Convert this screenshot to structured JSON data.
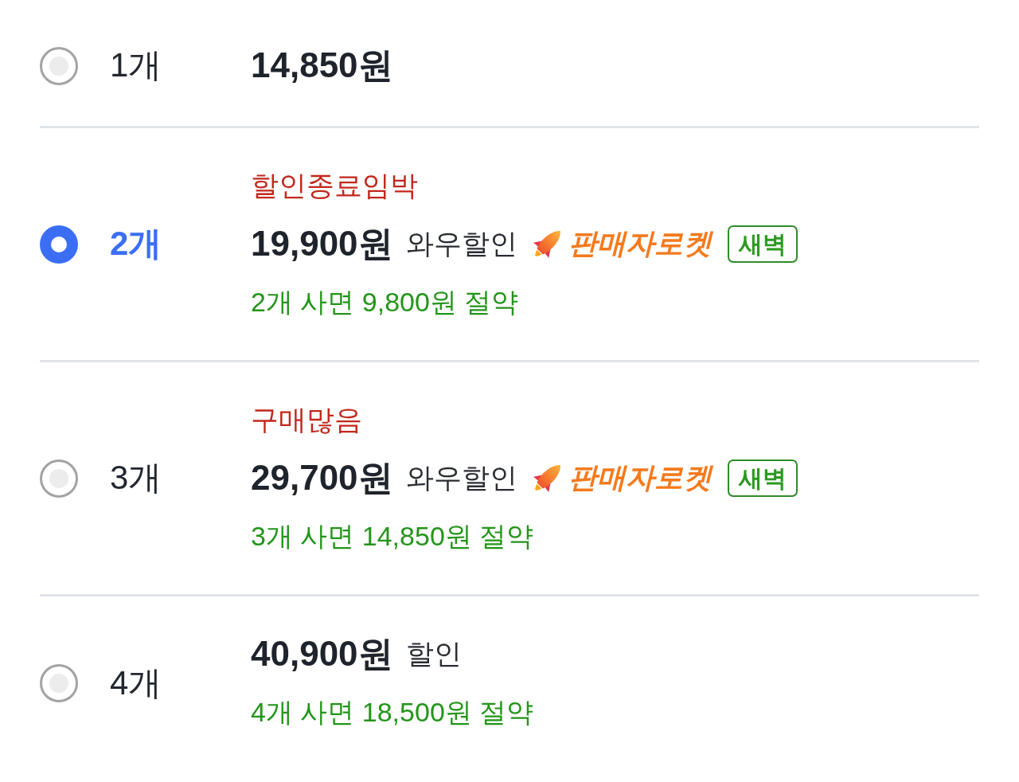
{
  "options": [
    {
      "quantity": "1개",
      "selected": false,
      "price": "14,850원"
    },
    {
      "quantity": "2개",
      "selected": true,
      "tag": "할인종료임박",
      "price": "19,900원",
      "discount": "와우할인",
      "delivery": {
        "label": "판매자로켓",
        "badge": "새벽"
      },
      "savings": "2개 사면 9,800원 절약"
    },
    {
      "quantity": "3개",
      "selected": false,
      "tag": "구매많음",
      "price": "29,700원",
      "discount": "와우할인",
      "delivery": {
        "label": "판매자로켓",
        "badge": "새벽"
      },
      "savings": "3개 사면 14,850원 절약"
    },
    {
      "quantity": "4개",
      "selected": false,
      "price": "40,900원",
      "discount": "할인",
      "savings": "4개 사면 18,500원 절약"
    }
  ]
}
